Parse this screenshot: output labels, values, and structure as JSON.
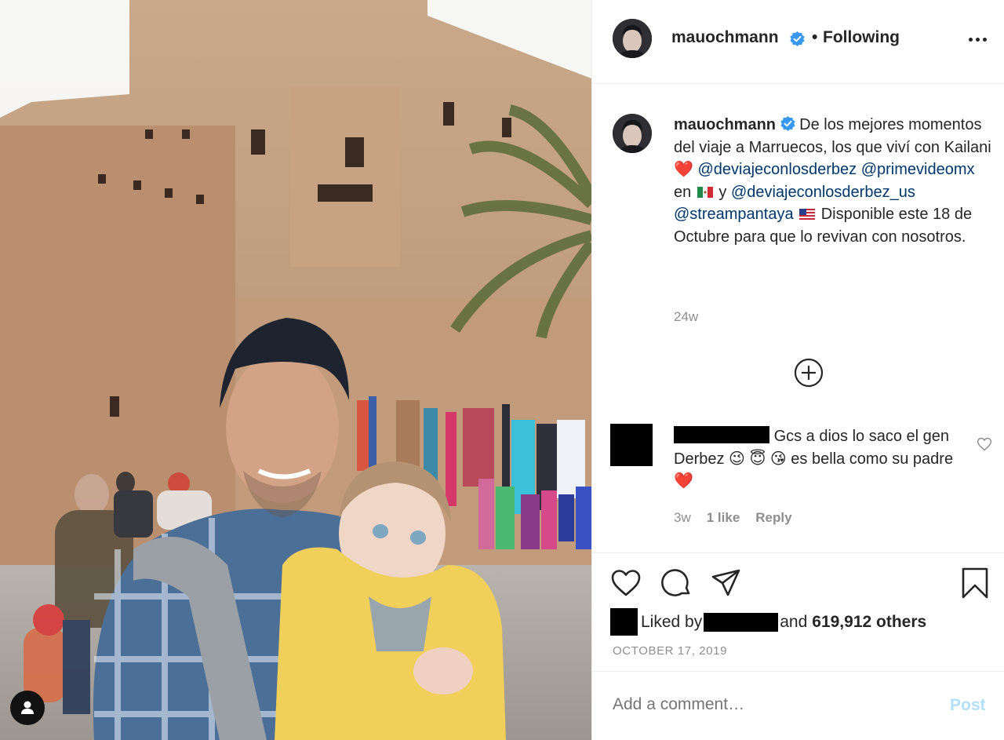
{
  "header": {
    "username": "mauochmann",
    "dot": "•",
    "follow_status": "Following",
    "avatar_icon": "profile-avatar",
    "verified_icon": "verified-badge-icon",
    "more_icon": "more-options-icon"
  },
  "caption": {
    "username": "mauochmann",
    "text_1": "De los mejores momentos del viaje a Marruecos, los que viví con Kailani",
    "heart": "❤️",
    "mention_1": "@deviajeconlosderbez",
    "mention_2": "@primevideomx",
    "word_en": "en",
    "word_y": "y",
    "mention_3": "@deviajeconlosderbez_us",
    "mention_4": "@streampantaya",
    "text_2": "Disponible este 18 de Octubre para que lo revivan con nosotros.",
    "time": "24w"
  },
  "load_more_icon": "plus-circle-icon",
  "comment": {
    "text_1": "Gcs a dios lo saco el gen Derbez",
    "emojis": "😉 😇 😘",
    "text_2": "es bella como su padre",
    "heart": "❤️",
    "time": "3w",
    "likes": "1 like",
    "reply": "Reply"
  },
  "actions": {
    "icons": [
      "heart-icon",
      "comment-icon",
      "share-icon",
      "bookmark-icon"
    ],
    "liked_by": "Liked by",
    "and": "and",
    "others": "619,912 others",
    "date": "OCTOBER 17, 2019"
  },
  "add_comment": {
    "placeholder": "Add a comment…",
    "post_label": "Post"
  },
  "colors": {
    "link": "#00376b",
    "muted": "#8e8e8e",
    "verified": "#3897f0",
    "post_disabled": "#b2dffc"
  }
}
